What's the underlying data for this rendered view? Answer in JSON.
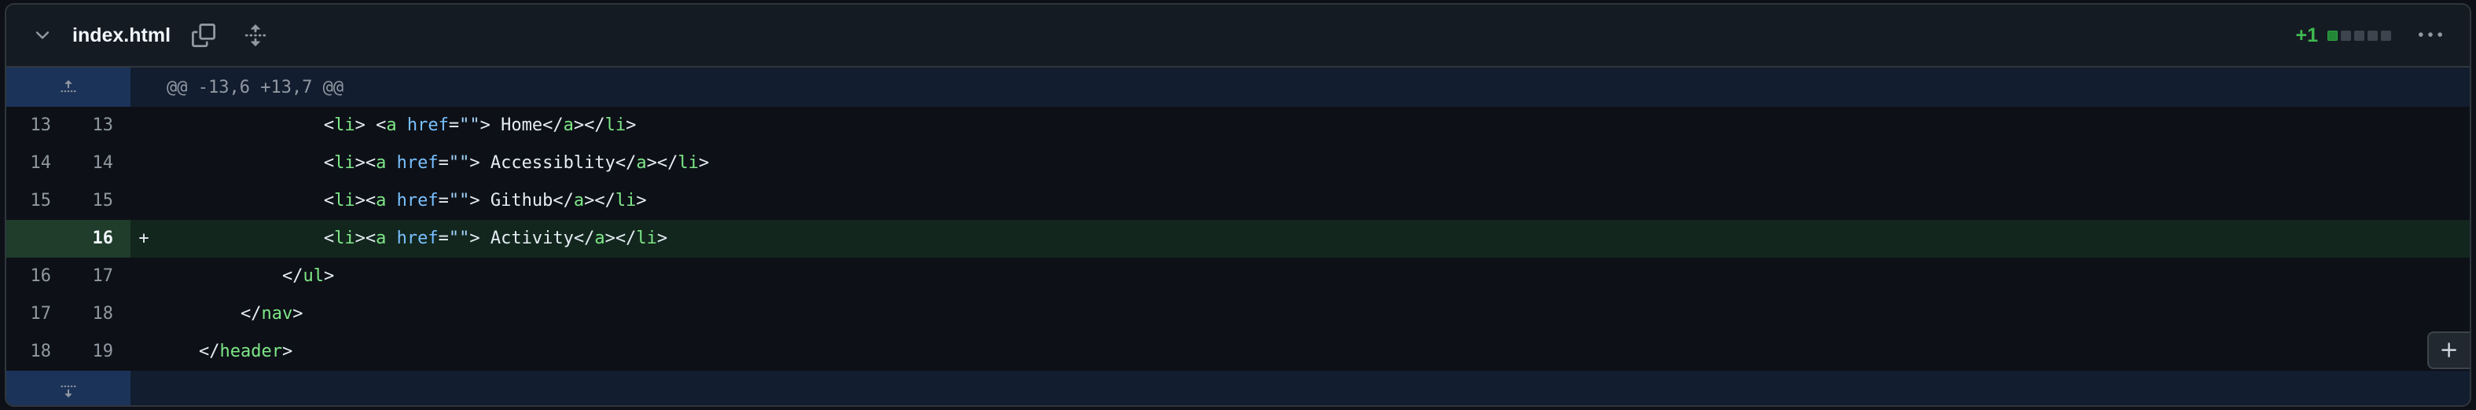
{
  "file": {
    "name": "index.html",
    "diffstat": {
      "label": "+1",
      "blocks": [
        "add",
        "neutral",
        "neutral",
        "neutral",
        "neutral"
      ]
    }
  },
  "icons": {
    "collapse": "chevron-down-icon",
    "copy": "copy-icon",
    "expand_all": "unfold-icon",
    "more": "kebab-horizontal-icon",
    "expand_up": "fold-up-icon",
    "expand_down": "fold-down-icon",
    "add_comment": "plus-icon"
  },
  "hunk": {
    "header": "@@ -13,6 +13,7 @@"
  },
  "lines": [
    {
      "old": "13",
      "new": "13",
      "marker": "",
      "indent": "                ",
      "tokens": [
        [
          "p",
          "<"
        ],
        [
          "tag",
          "li"
        ],
        [
          "p",
          "> <"
        ],
        [
          "tag",
          "a"
        ],
        [
          "p",
          " "
        ],
        [
          "attr",
          "href"
        ],
        [
          "p",
          "="
        ],
        [
          "str",
          "\"\""
        ],
        [
          "p",
          "> Home</"
        ],
        [
          "tag",
          "a"
        ],
        [
          "p",
          "></"
        ],
        [
          "tag",
          "li"
        ],
        [
          "p",
          ">"
        ]
      ]
    },
    {
      "old": "14",
      "new": "14",
      "marker": "",
      "indent": "                ",
      "tokens": [
        [
          "p",
          "<"
        ],
        [
          "tag",
          "li"
        ],
        [
          "p",
          "><"
        ],
        [
          "tag",
          "a"
        ],
        [
          "p",
          " "
        ],
        [
          "attr",
          "href"
        ],
        [
          "p",
          "="
        ],
        [
          "str",
          "\"\""
        ],
        [
          "p",
          "> Accessiblity</"
        ],
        [
          "tag",
          "a"
        ],
        [
          "p",
          "></"
        ],
        [
          "tag",
          "li"
        ],
        [
          "p",
          ">"
        ]
      ]
    },
    {
      "old": "15",
      "new": "15",
      "marker": "",
      "indent": "                ",
      "tokens": [
        [
          "p",
          "<"
        ],
        [
          "tag",
          "li"
        ],
        [
          "p",
          "><"
        ],
        [
          "tag",
          "a"
        ],
        [
          "p",
          " "
        ],
        [
          "attr",
          "href"
        ],
        [
          "p",
          "="
        ],
        [
          "str",
          "\"\""
        ],
        [
          "p",
          "> Github</"
        ],
        [
          "tag",
          "a"
        ],
        [
          "p",
          "></"
        ],
        [
          "tag",
          "li"
        ],
        [
          "p",
          ">"
        ]
      ]
    },
    {
      "old": "",
      "new": "16",
      "marker": "+",
      "added": true,
      "indent": "                ",
      "tokens": [
        [
          "p",
          "<"
        ],
        [
          "tag",
          "li"
        ],
        [
          "p",
          "><"
        ],
        [
          "tag",
          "a"
        ],
        [
          "p",
          " "
        ],
        [
          "attr",
          "href"
        ],
        [
          "p",
          "="
        ],
        [
          "str",
          "\"\""
        ],
        [
          "p",
          "> Activity</"
        ],
        [
          "tag",
          "a"
        ],
        [
          "p",
          "></"
        ],
        [
          "tag",
          "li"
        ],
        [
          "p",
          ">"
        ]
      ]
    },
    {
      "old": "16",
      "new": "17",
      "marker": "",
      "indent": "            ",
      "tokens": [
        [
          "p",
          "</"
        ],
        [
          "tag",
          "ul"
        ],
        [
          "p",
          ">"
        ]
      ]
    },
    {
      "old": "17",
      "new": "18",
      "marker": "",
      "indent": "        ",
      "tokens": [
        [
          "p",
          "</"
        ],
        [
          "tag",
          "nav"
        ],
        [
          "p",
          ">"
        ]
      ]
    },
    {
      "old": "18",
      "new": "19",
      "marker": "",
      "indent": "    ",
      "tokens": [
        [
          "p",
          "</"
        ],
        [
          "tag",
          "header"
        ],
        [
          "p",
          ">"
        ]
      ]
    }
  ],
  "colors": {
    "background": "#0d1117",
    "added_line": "#12261e",
    "added_number": "#1f3d2a",
    "hunk": "#121d2f",
    "hunk_expander": "#1c3359",
    "diffstat_add": "#3fb950"
  }
}
